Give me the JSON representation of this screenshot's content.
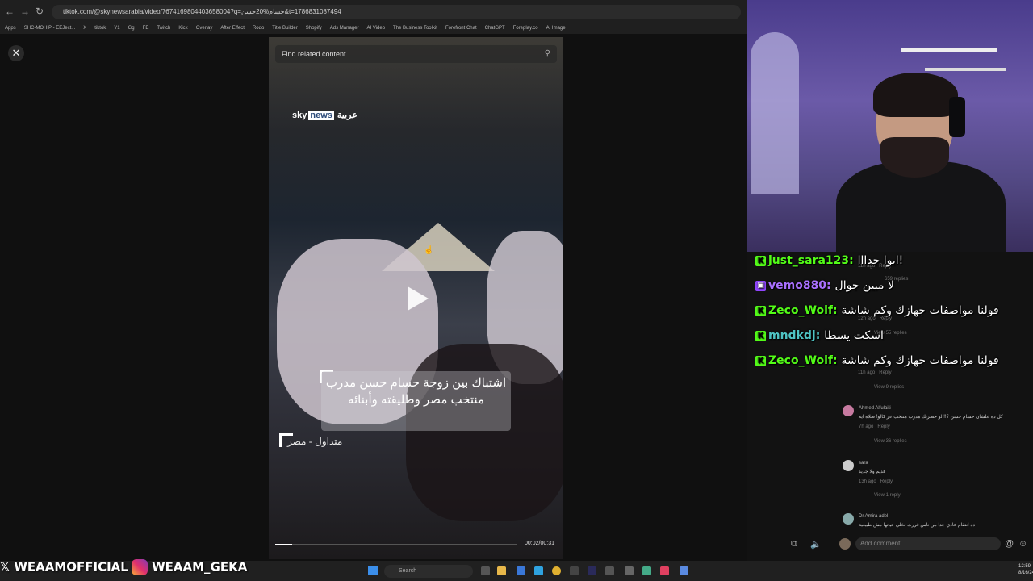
{
  "browser": {
    "url": "tiktok.com/@skynewsarabia/video/7674169804403658004?q=حسام%20حسن&t=1786831087494",
    "bookmarks": [
      "Apps",
      "SHC-MOHIP - EEJect...",
      "X",
      "tiktok",
      "Y1",
      "Gg",
      "FE",
      "Twitch",
      "Kick",
      "Overlay",
      "After Effect",
      "Rodo",
      "Title Builder",
      "Shopify",
      "Ads Manager",
      "AI Video",
      "The Business Toolkit",
      "Forefront Chat",
      "ChatGPT",
      "Foreplay.co",
      "AI Image"
    ]
  },
  "video": {
    "search_placeholder": "Find related content",
    "logo_sky": "sky",
    "logo_news": "news",
    "logo_arabic": "عربية",
    "caption": "اشتباك بين زوجة حسام حسن مدرب منتخب مصر وطليقته وأبنائه",
    "source": "متداول - مصر",
    "time": "00:02/00:31",
    "progress": 0.07
  },
  "chat": [
    {
      "platform": "kick",
      "user": "just_sara123:",
      "color": "#53fc18",
      "message": "ابوا جدااا!"
    },
    {
      "platform": "twitch",
      "user": "vemo880:",
      "color": "#a970ff",
      "message": "لا مبين جوال"
    },
    {
      "platform": "kick",
      "user": "Zeco_Wolf:",
      "color": "#53fc18",
      "message": "قولنا مواصفات جهازك وكم شاشة"
    },
    {
      "platform": "kick",
      "user": "mndkdj:",
      "color": "#4fc3c3",
      "message": "اسكت يسطا"
    },
    {
      "platform": "kick",
      "user": "Zeco_Wolf:",
      "color": "#53fc18",
      "message": "قولنا مواصفات جهازك وكم شاشة"
    }
  ],
  "comments": {
    "items": [
      {
        "meta": "11h ago",
        "reply": "Reply"
      },
      {
        "meta": "659 replies"
      },
      {
        "meta": "12h ago",
        "reply": "Reply"
      },
      {
        "meta": "View 55 replies"
      },
      {
        "meta": "11h ago",
        "reply": "Reply"
      },
      {
        "meta": "View 9 replies"
      },
      {
        "name": "Ahmed Alfulaiti",
        "text": "كل ده علشان حسام حسن ؟!! لو حضرتك مدرب منتخب عز كالو! صلاة ايه",
        "meta": "7h ago",
        "reply": "Reply",
        "replies": "View 36 replies"
      },
      {
        "name": "sara",
        "text": "قديم ولا جديد",
        "meta": "13h ago",
        "reply": "Reply",
        "replies": "View 1 reply"
      },
      {
        "name": "Dr Amira adel",
        "text": "ده انتقام عادي جدا من ناس قررت تخلي حياتها مش طبيعية"
      }
    ],
    "add_comment": "Add comment..."
  },
  "social": {
    "x_handle": "WEAAMOFFICIAL",
    "ig_handle": "WEAAM_GEKA"
  },
  "taskbar": {
    "search": "Search",
    "time": "12:59",
    "date": "8/16/24"
  }
}
